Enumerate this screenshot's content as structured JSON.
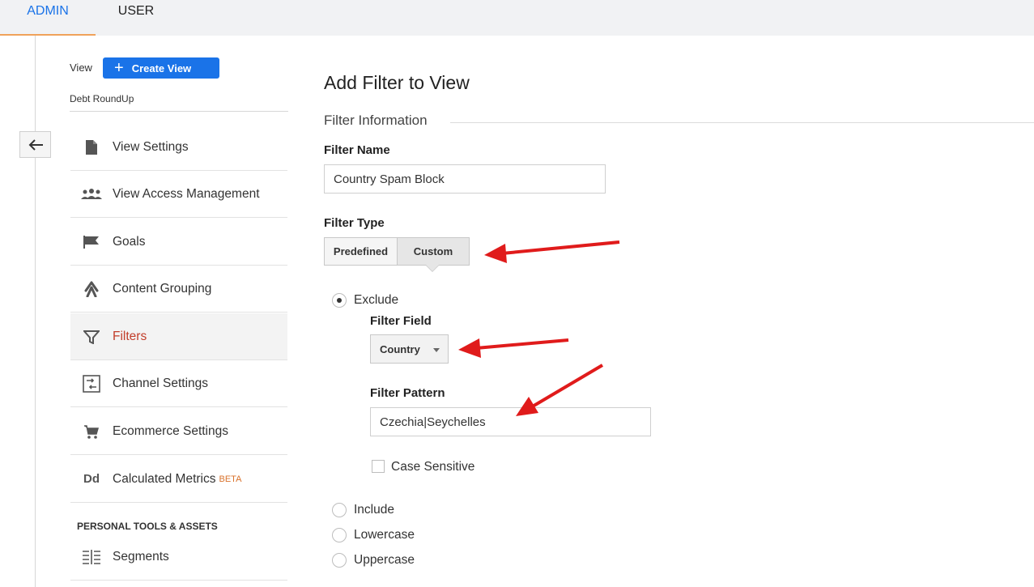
{
  "tabs": [
    {
      "label": "ADMIN",
      "active": true
    },
    {
      "label": "USER",
      "active": false
    }
  ],
  "sidebar": {
    "view_label": "View",
    "create_view_label": "Create View",
    "view_name": "Debt RoundUp",
    "items": [
      {
        "label": "View Settings",
        "icon": "document-icon"
      },
      {
        "label": "View Access Management",
        "icon": "people-icon"
      },
      {
        "label": "Goals",
        "icon": "flag-icon"
      },
      {
        "label": "Content Grouping",
        "icon": "content-grouping-icon"
      },
      {
        "label": "Filters",
        "icon": "filter-icon",
        "active": true
      },
      {
        "label": "Channel Settings",
        "icon": "channel-settings-icon"
      },
      {
        "label": "Ecommerce Settings",
        "icon": "cart-icon"
      },
      {
        "label": "Calculated Metrics",
        "icon": "dd-icon",
        "badge": "BETA"
      }
    ],
    "section_title": "PERSONAL TOOLS & ASSETS",
    "section_items": [
      {
        "label": "Segments",
        "icon": "segments-icon"
      }
    ]
  },
  "main": {
    "title": "Add Filter to View",
    "section_title": "Filter Information",
    "filter_name_label": "Filter Name",
    "filter_name_value": "Country Spam Block",
    "filter_type_label": "Filter Type",
    "filter_type_options": [
      "Predefined",
      "Custom"
    ],
    "filter_type_selected": "Custom",
    "options": {
      "exclude": "Exclude",
      "include": "Include",
      "lowercase": "Lowercase",
      "uppercase": "Uppercase"
    },
    "selected_option": "Exclude",
    "filter_field_label": "Filter Field",
    "filter_field_value": "Country",
    "filter_pattern_label": "Filter Pattern",
    "filter_pattern_value": "Czechia|Seychelles",
    "case_sensitive_label": "Case Sensitive",
    "case_sensitive_checked": false
  },
  "colors": {
    "accent": "#1a73e8",
    "active_nav": "#c23d2a",
    "tab_underline": "#f0a25a",
    "annotation_arrow": "#e01b1b"
  }
}
